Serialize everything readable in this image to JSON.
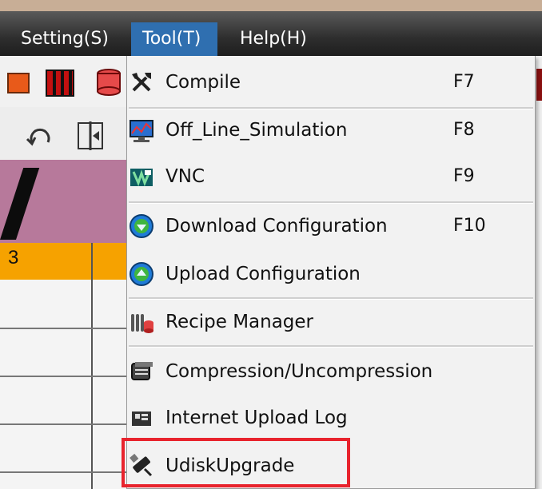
{
  "menubar": {
    "items": [
      {
        "label": "Setting(S)"
      },
      {
        "label": "Tool(T)"
      },
      {
        "label": "Help(H)"
      }
    ]
  },
  "background": {
    "table_cell": "3"
  },
  "tool_menu": {
    "items": [
      {
        "label": "Compile",
        "shortcut": "F7",
        "icon": "tools-icon"
      },
      {
        "label": "Off_Line_Simulation",
        "shortcut": "F8",
        "icon": "simulation-icon"
      },
      {
        "label": "VNC",
        "shortcut": "F9",
        "icon": "vnc-icon"
      },
      {
        "label": "Download Configuration",
        "shortcut": "F10",
        "icon": "download-icon"
      },
      {
        "label": "Upload Configuration",
        "shortcut": "",
        "icon": "upload-icon"
      },
      {
        "label": "Recipe Manager",
        "shortcut": "",
        "icon": "recipe-icon"
      },
      {
        "label": "Compression/Uncompression",
        "shortcut": "",
        "icon": "compression-icon"
      },
      {
        "label": "Internet Upload Log",
        "shortcut": "",
        "icon": "upload-log-icon"
      },
      {
        "label": "UdiskUpgrade",
        "shortcut": "",
        "icon": "usb-icon"
      }
    ]
  },
  "colors": {
    "menubar": "#2e2e2e",
    "active_menu": "#2f6fb0",
    "highlight_border": "#e8232d"
  }
}
